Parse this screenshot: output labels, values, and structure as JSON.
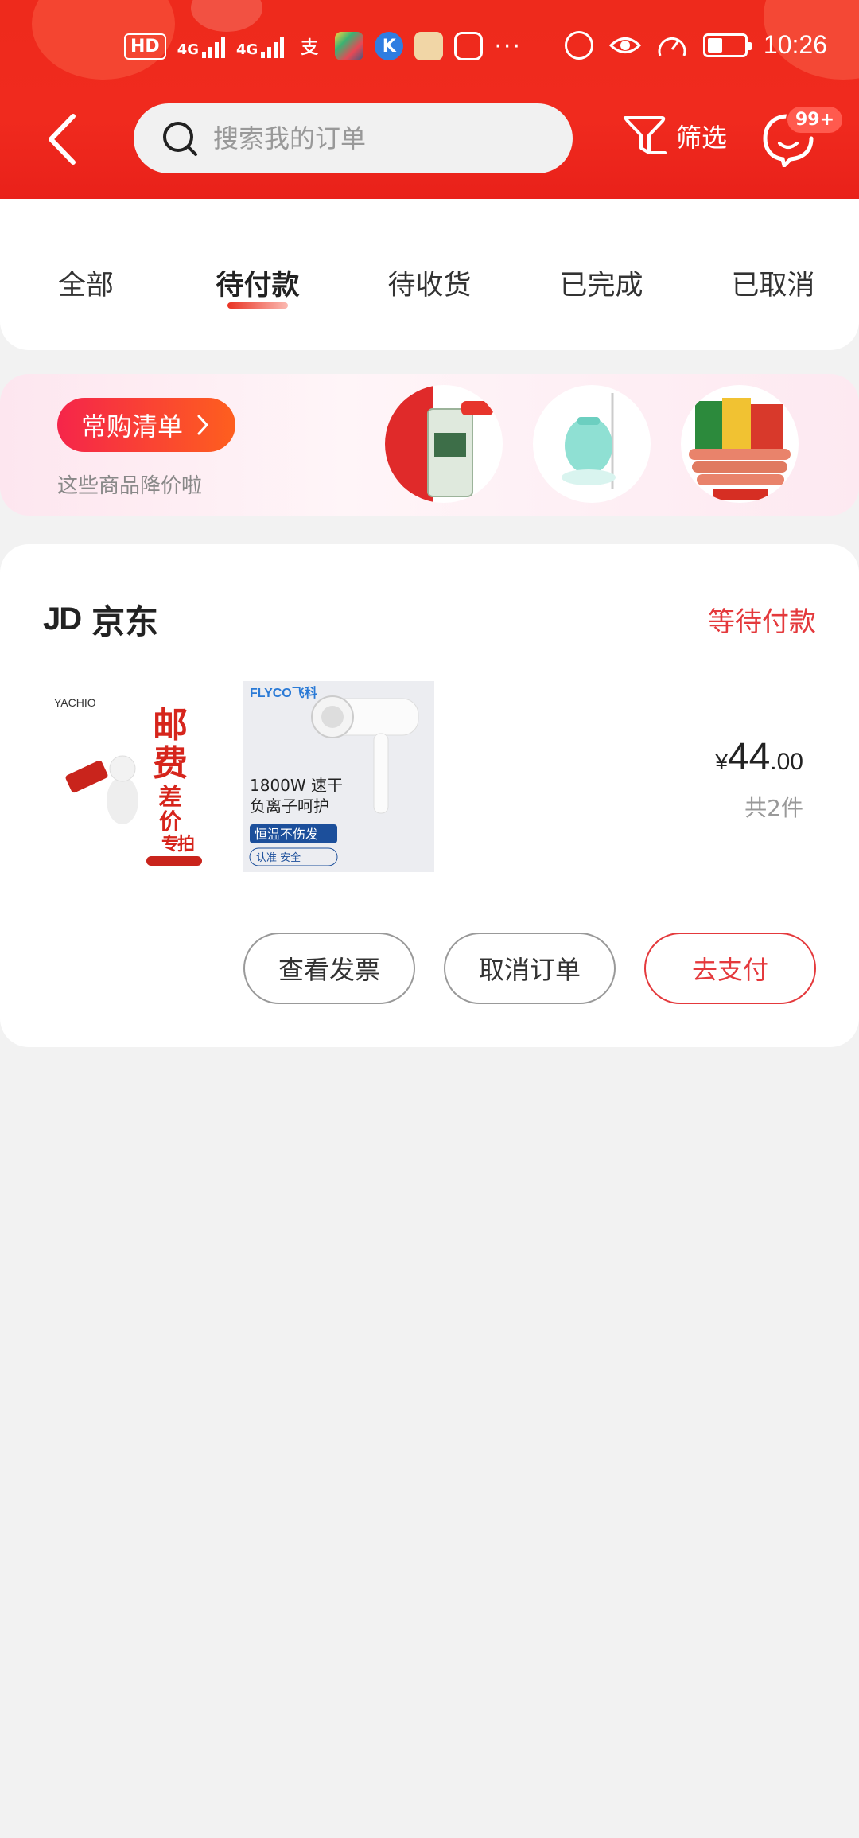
{
  "status_bar": {
    "hd_badge": "HD",
    "sim_label": "2",
    "net1": "4G",
    "net2": "4G",
    "app_icons": [
      "alipay-icon",
      "photos-icon",
      "k-app-icon",
      "news-app-icon",
      "hand-app-icon"
    ],
    "more": "···",
    "time": "10:26"
  },
  "header": {
    "search_placeholder": "搜索我的订单",
    "filter_label": "筛选",
    "message_badge": "99+"
  },
  "tabs": [
    "全部",
    "待付款",
    "待收货",
    "已完成",
    "已取消"
  ],
  "active_tab": 1,
  "banner": {
    "button_label": "常购清单",
    "subtitle": "这些商品降价啦",
    "thumbs": [
      "rice-bag-thumb",
      "garment-steamer-thumb",
      "sausage-pack-thumb"
    ]
  },
  "order": {
    "shop_logo": "JD",
    "shop_name": "京东",
    "status": "等待付款",
    "products": [
      {
        "brand": "YACHIO",
        "text": [
          "邮",
          "费",
          "差",
          "价",
          "专",
          "拍"
        ]
      },
      {
        "brand": "FLYCO飞科",
        "line1": "1800W 速干",
        "line2": "负离子呵护",
        "tag1": "恒温不伤发",
        "tag2": "认准 安全"
      }
    ],
    "price_currency": "¥",
    "price_int": "44",
    "price_dec": ".00",
    "count": "共2件",
    "buttons": {
      "invoice": "查看发票",
      "cancel": "取消订单",
      "pay": "去支付"
    }
  },
  "colors": {
    "header_red": "#ee2a1c",
    "accent_red": "#e4393c"
  }
}
